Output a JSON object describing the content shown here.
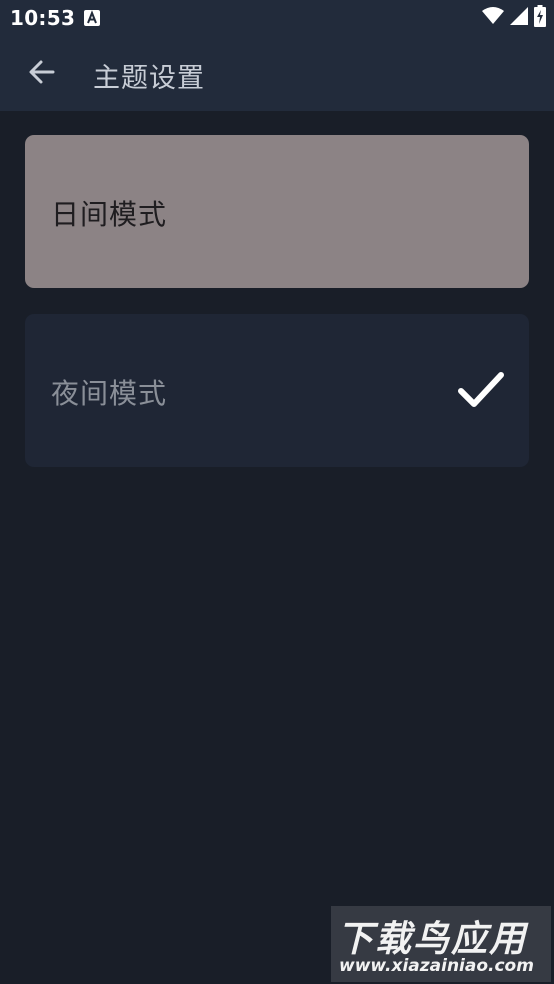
{
  "status_bar": {
    "time": "10:53",
    "app_icon": "font-a-icon",
    "icons": [
      "wifi-icon",
      "signal-icon",
      "battery-charging-icon"
    ]
  },
  "toolbar": {
    "back_icon": "arrow-left-icon",
    "title": "主题设置"
  },
  "options": [
    {
      "label": "日间模式",
      "selected": false,
      "background": "#8c8385"
    },
    {
      "label": "夜间模式",
      "selected": true,
      "background": "#1f2635"
    }
  ],
  "check_icon": "checkmark-icon",
  "watermark": {
    "title": "下载鸟应用",
    "url": "www.xiazainiao.com"
  },
  "colors": {
    "app_background": "#191e28",
    "toolbar_background": "#222b3b",
    "title_text": "#c8cdd6"
  }
}
